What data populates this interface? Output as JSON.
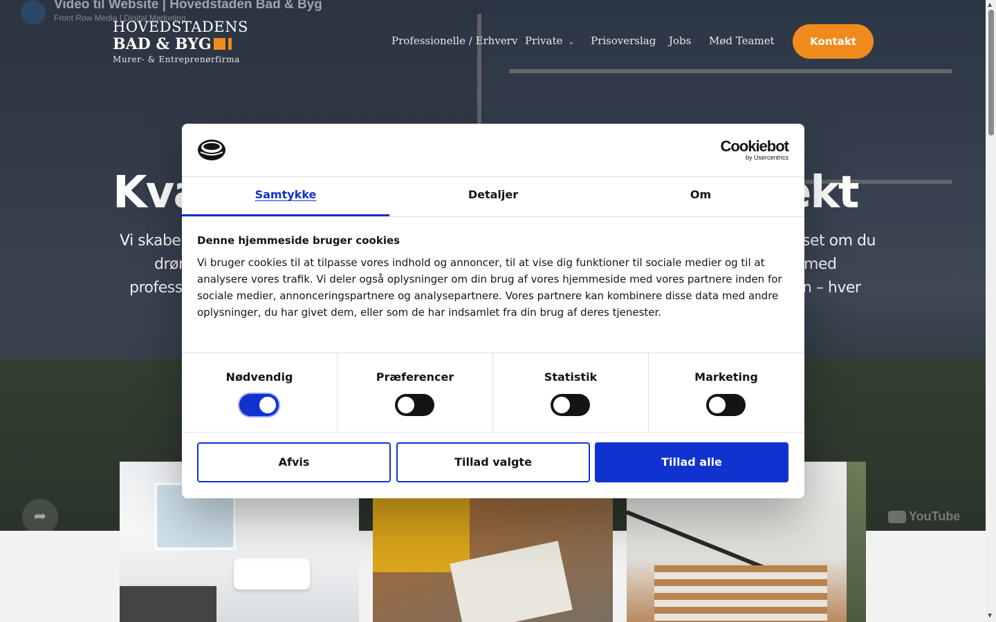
{
  "video": {
    "title": "Video til Website | Hovedstaden Bad & Byg",
    "channel": "Front Row Media | Digital Marketing",
    "share_icon": "share-icon",
    "youtube_label": "YouTube"
  },
  "logo": {
    "line1": "HOVEDSTADENS",
    "line2": "BAD & BYG",
    "line3": "Murer- & Entreprenørfirma",
    "accent_color": "#f08a1d"
  },
  "nav": {
    "items": [
      {
        "label": "Professionelle / Erhverv"
      },
      {
        "label": "Private",
        "has_dropdown": true
      },
      {
        "label": "Prisoverslag"
      },
      {
        "label": "Jobs"
      },
      {
        "label": "Mød Teamet"
      }
    ],
    "cta_label": "Kontakt",
    "cta_color": "#f08a1d"
  },
  "hero": {
    "title_visible_left": "Kva",
    "title_visible_right": "jekt",
    "sub_line1_left": "Vi skaber",
    "sub_line1_right": "set om du",
    "sub_line2_left": "drøm",
    "sub_line2_right": "med",
    "sub_line3_left": "profess",
    "sub_line3_right": "n – hver"
  },
  "cookie": {
    "brand_name": "Cookiebot",
    "brand_by": "by Usercentrics",
    "tabs": [
      {
        "label": "Samtykke",
        "active": true
      },
      {
        "label": "Detaljer",
        "active": false
      },
      {
        "label": "Om",
        "active": false
      }
    ],
    "heading": "Denne hjemmeside bruger cookies",
    "body": "Vi bruger cookies til at tilpasse vores indhold og annoncer, til at vise dig funktioner til sociale medier og til at analysere vores trafik. Vi deler også oplysninger om din brug af vores hjemmeside med vores partnere inden for sociale medier, annonceringspartnere og analysepartnere. Vores partnere kan kombinere disse data med andre oplysninger, du har givet dem, eller som de har indsamlet fra din brug af deres tjenester.",
    "categories": [
      {
        "label": "Nødvendig",
        "checked": true
      },
      {
        "label": "Præferencer",
        "checked": false
      },
      {
        "label": "Statistik",
        "checked": false
      },
      {
        "label": "Marketing",
        "checked": false
      }
    ],
    "buttons": {
      "reject": "Afvis",
      "allow_selected": "Tillad valgte",
      "allow_all": "Tillad alle"
    },
    "accent_color": "#1032cf"
  }
}
